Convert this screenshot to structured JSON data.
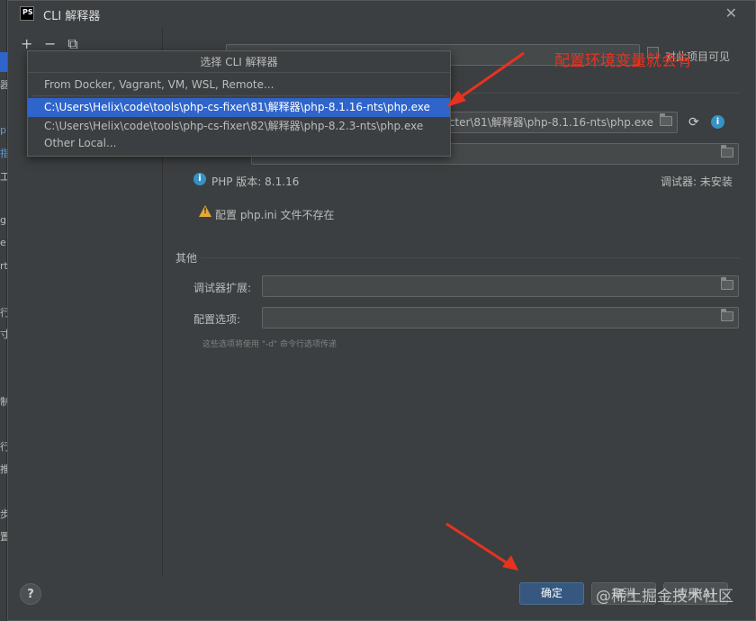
{
  "dialog": {
    "title": "CLI 解释器",
    "logo_text": "PS",
    "close_glyph": "✕"
  },
  "outer_strip": {
    "glyphs": [
      "器",
      "p",
      "指",
      "工",
      "g",
      "e",
      "rt",
      "行",
      "寸",
      "制",
      "行",
      "推",
      "步",
      "置"
    ]
  },
  "left_toolbar": {
    "add_glyph": "+",
    "remove_glyph": "−",
    "copy_glyph": "⧉"
  },
  "form": {
    "visible_label": "对此项目可见",
    "exe_path_tail": "cter\\81\\解释器\\php-8.1.16-nts\\php.exe",
    "php_version": "PHP 版本: 8.1.16",
    "debugger_status": "调试器: 未安装",
    "warning": "配置 php.ini 文件不存在",
    "other_section": "其他",
    "debug_ext_label": "调试器扩展:",
    "config_opts_label": "配置选项:",
    "hint": "这些选项将使用 \"-d\" 命令行选项传递"
  },
  "popup": {
    "title": "选择 CLI 解释器",
    "items": [
      "From Docker, Vagrant, VM, WSL, Remote...",
      "C:\\Users\\Helix\\code\\tools\\php-cs-fixer\\81\\解释器\\php-8.1.16-nts\\php.exe",
      "C:\\Users\\Helix\\code\\tools\\php-cs-fixer\\82\\解释器\\php-8.2.3-nts\\php.exe",
      "Other Local..."
    ],
    "selected_index": 1
  },
  "annotation": {
    "text": "配置环境变量就会有",
    "color": "#e8321f"
  },
  "buttons": {
    "help": "?",
    "ok": "确定",
    "cancel": "取消",
    "apply": "应用(A)"
  },
  "watermark": "@稀土掘金技术社区"
}
